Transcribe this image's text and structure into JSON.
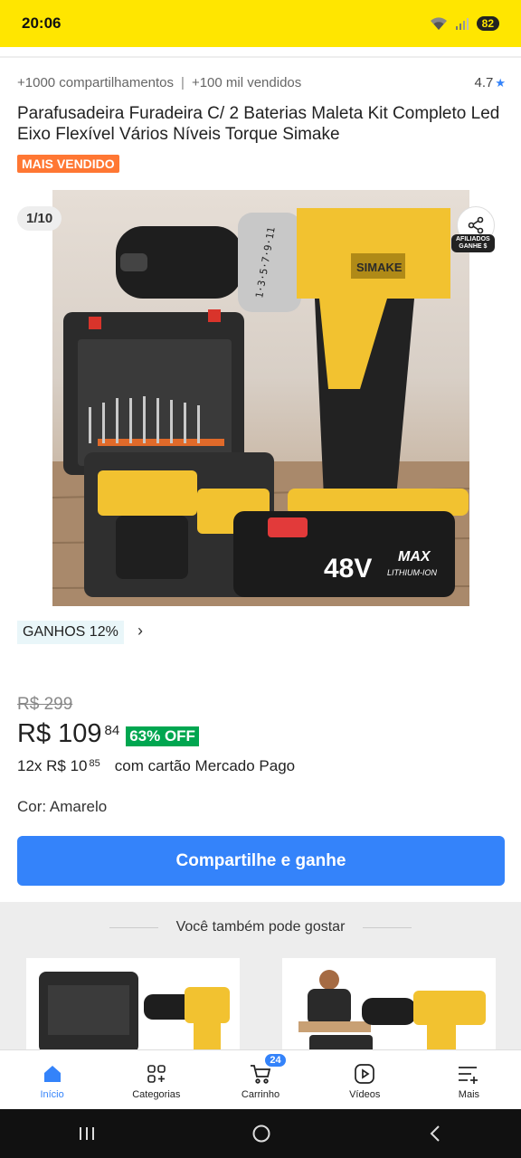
{
  "status": {
    "time": "20:06",
    "battery": "82"
  },
  "product": {
    "shares": "+1000 compartilhamentos",
    "sold": "+100 mil vendidos",
    "rating": "4.7",
    "title": "Parafusadeira Furadeira C/ 2 Baterias Maleta Kit Completo Led Eixo Flexível Vários Níveis Torque Simake",
    "best_seller": "MAIS VENDIDO",
    "image_counter": "1/10",
    "affiliate_label_1": "AFILIADOS",
    "affiliate_label_2": "GANHE $",
    "earnings": "GANHOS 12%",
    "old_price": "R$ 299",
    "price_main": "R$ 109",
    "price_cents": "84",
    "discount": "63% OFF",
    "installments_main": "12x R$ 10",
    "installments_cents": "85",
    "installments_tail": "com cartão Mercado Pago",
    "color_label": "Cor: Amarelo",
    "share_cta": "Compartilhe e ganhe"
  },
  "image_text": {
    "brand": "SIMAKE",
    "voltage": "48V",
    "max": "MAX",
    "lithium": "LITHIUM-ION",
    "torque_scale": "1·3·5·7·9·11"
  },
  "recommendations": {
    "title": "Você também pode gostar"
  },
  "bottom_nav": [
    {
      "label": "Início",
      "icon": "home-icon"
    },
    {
      "label": "Categorias",
      "icon": "categories-icon"
    },
    {
      "label": "Carrinho",
      "icon": "cart-icon",
      "badge": "24"
    },
    {
      "label": "Vídeos",
      "icon": "play-icon"
    },
    {
      "label": "Mais",
      "icon": "menu-icon"
    }
  ],
  "colors": {
    "brand_yellow": "#ffe600",
    "accent_blue": "#3483fa",
    "discount_green": "#00a650",
    "best_seller_orange": "#ff7733"
  }
}
